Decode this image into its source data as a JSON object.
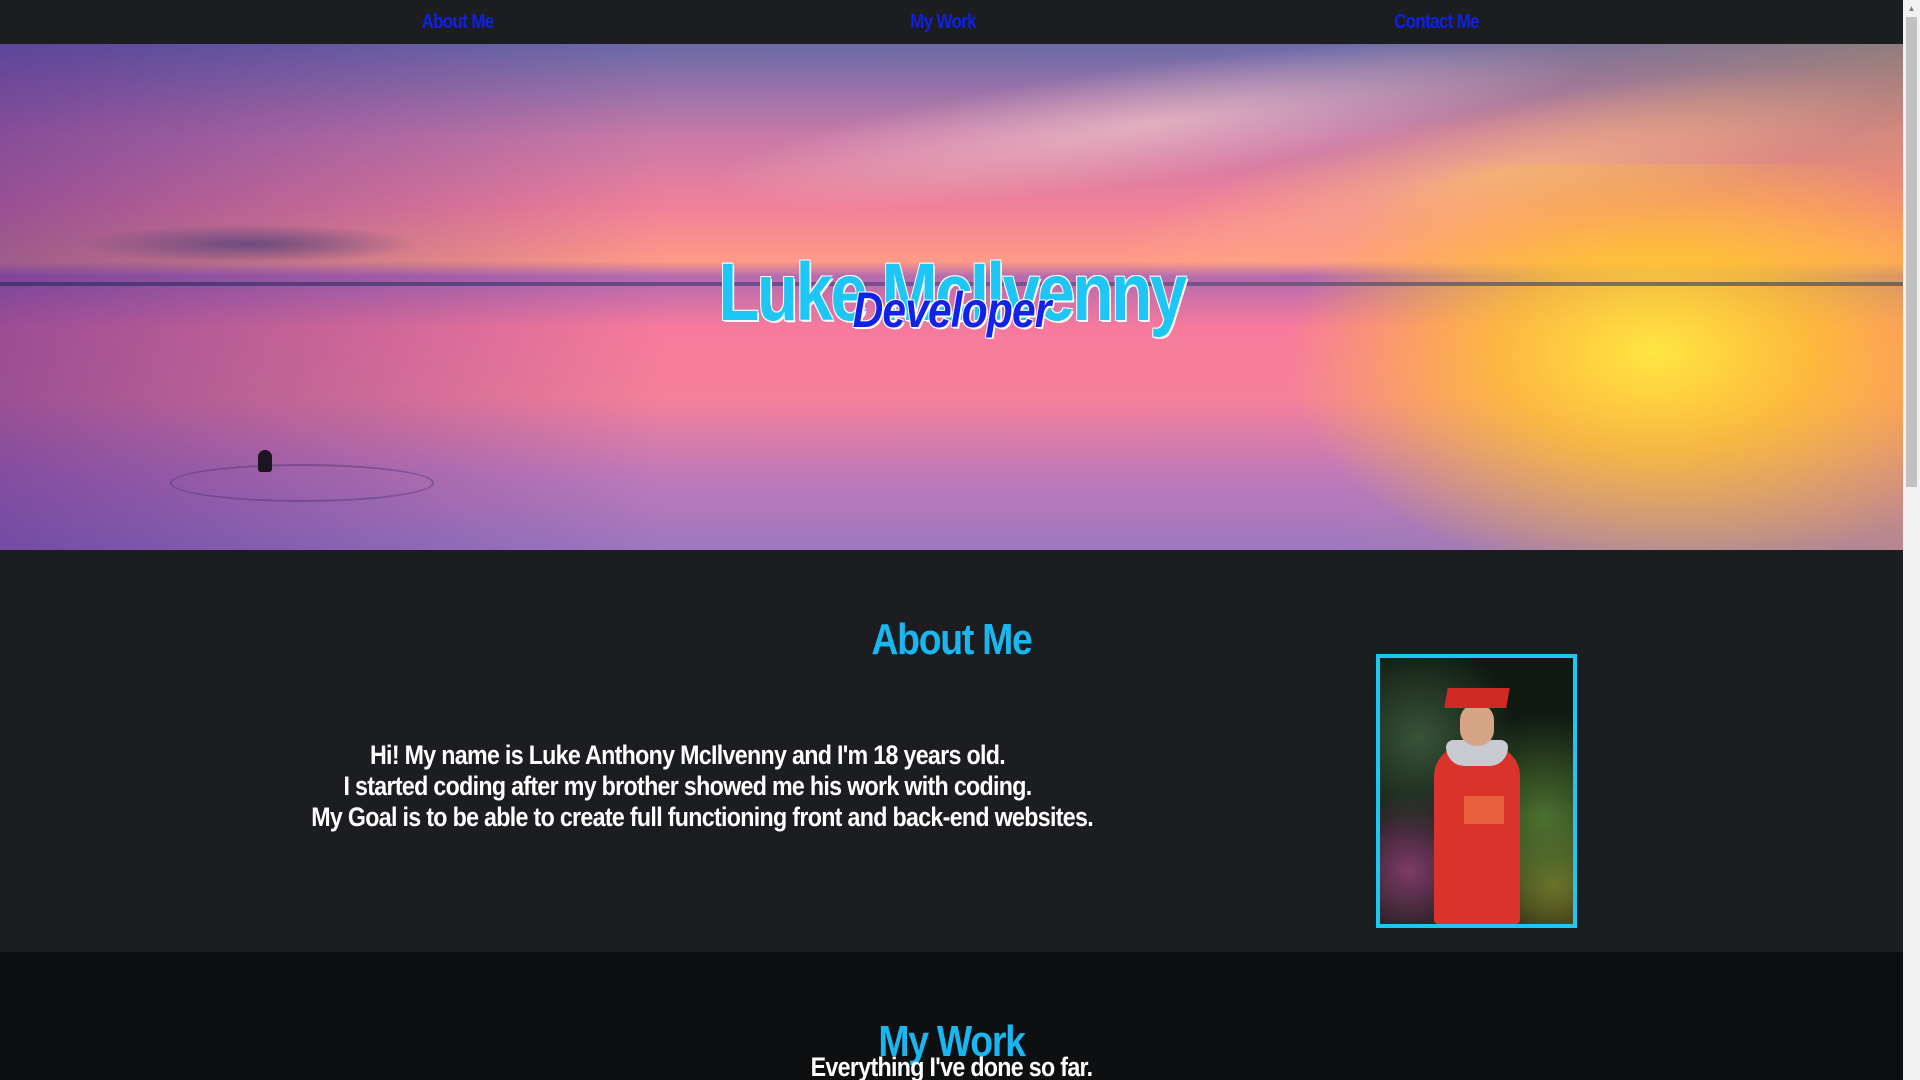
{
  "nav": {
    "about": "About Me",
    "work": "My Work",
    "contact": "Contact Me"
  },
  "hero": {
    "name": "Luke McIlvenny",
    "role": "Developer"
  },
  "about": {
    "heading": "About Me",
    "lines": [
      "Hi! My name is Luke Anthony McIlvenny and I'm 18 years old.",
      "I started coding after my brother showed me his work with coding.",
      "My Goal is to be able to create full functioning front and back-end websites."
    ]
  },
  "work": {
    "heading": "My Work",
    "subheading": "Everything I've done so far."
  },
  "colors": {
    "accent": "#1ec6f5",
    "nav_link": "#1020e6",
    "background": "#1b1d20"
  }
}
